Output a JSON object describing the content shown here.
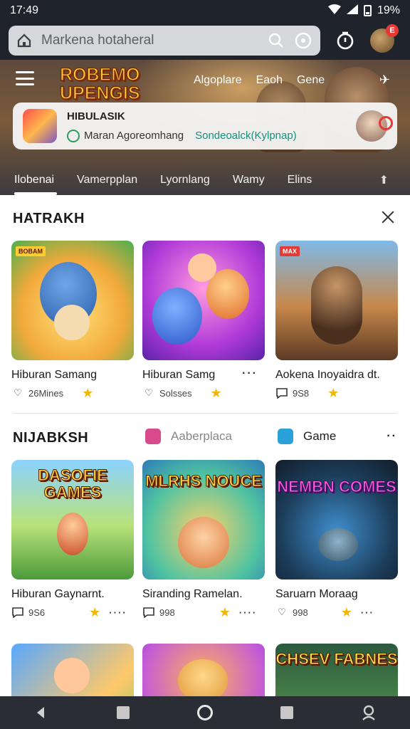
{
  "status_bar": {
    "time": "17:49",
    "battery": "19%"
  },
  "search": {
    "placeholder": "Markena hotaheral"
  },
  "notifications": {
    "badge": "E"
  },
  "hero": {
    "logo": "ROBEMO UPENGIS",
    "nav": [
      "Algoplare",
      "Eaoh",
      "Gene"
    ],
    "promo": {
      "title": "HIBULASIK",
      "subtitle": "Maran Agoreomhang",
      "link": "Sondeoalck(Kylpnap)"
    },
    "tabs": [
      "Ilobenai",
      "Vamerpplan",
      "Lyornlang",
      "Wamy",
      "Elins"
    ],
    "active_tab": 0
  },
  "sections": [
    {
      "title": "HATRAKH",
      "cards": [
        {
          "name": "Hiburan Samang",
          "meta": "26Mines",
          "tag": "BOBAM",
          "meta_icon": "heart-icon",
          "has_more": false
        },
        {
          "name": "Hiburan Samg",
          "meta": "Solsses",
          "tag": "",
          "meta_icon": "heart-icon",
          "has_more": true
        },
        {
          "name": "Aokena Inoyaidra dt.",
          "meta": "9S8",
          "tag": "MAX",
          "meta_icon": "chat-icon",
          "has_more": false
        }
      ]
    },
    {
      "title": "NIJABKSH",
      "filters": [
        {
          "label": "Aaberplaca",
          "icon": "apps-icon",
          "color": "#d94a8c"
        },
        {
          "label": "Game",
          "icon": "game-icon",
          "color": "#2aa1d8"
        }
      ],
      "cards": [
        {
          "name": "Hiburan Gaynarnt.",
          "meta": "9S6",
          "art": "DASOFIE GAMES",
          "meta_icon": "chat-icon",
          "has_more": true
        },
        {
          "name": "Siranding Ramelan.",
          "meta": "998",
          "art": "MLRHS NOUCE",
          "meta_icon": "chat-icon",
          "has_more": true
        },
        {
          "name": "Saruarn Moraag",
          "meta": "998",
          "art": "NEMBN COMES",
          "meta_icon": "heart-icon",
          "has_more": true
        }
      ]
    },
    {
      "cards": [
        {
          "art": ""
        },
        {
          "art": ""
        },
        {
          "art": "CHSEV FABNES"
        }
      ]
    }
  ]
}
